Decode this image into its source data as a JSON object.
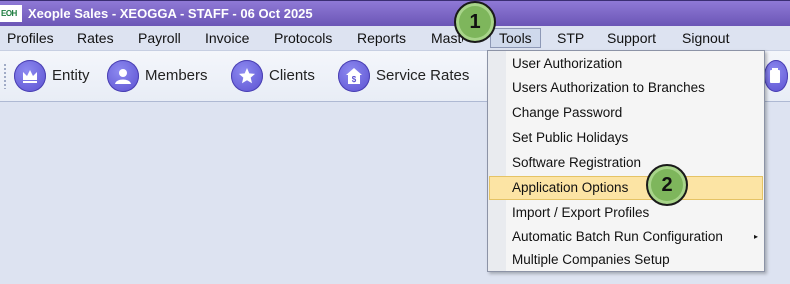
{
  "window": {
    "logo_text": "EOH",
    "title": "Xeople Sales - XEOGGA - STAFF - 06 Oct 2025"
  },
  "menu": [
    {
      "label": "Profiles"
    },
    {
      "label": "Rates"
    },
    {
      "label": "Payroll"
    },
    {
      "label": "Invoice"
    },
    {
      "label": "Protocols"
    },
    {
      "label": "Reports"
    },
    {
      "label": "Masters"
    },
    {
      "label": "Tools",
      "active": true
    },
    {
      "label": "STP"
    },
    {
      "label": "Support"
    },
    {
      "label": "Signout"
    }
  ],
  "toolbar": [
    {
      "label": "Entity",
      "icon": "crown-icon"
    },
    {
      "label": "Members",
      "icon": "user-icon"
    },
    {
      "label": "Clients",
      "icon": "star-icon"
    },
    {
      "label": "Service Rates",
      "icon": "dollar-house-icon"
    }
  ],
  "toolbar_overflow_icon": "clipboard-icon",
  "tools_menu": [
    {
      "label": "User Authorization"
    },
    {
      "label": "Users Authorization to Branches"
    },
    {
      "label": "Change Password"
    },
    {
      "label": "Set Public Holidays"
    },
    {
      "label": "Software Registration"
    },
    {
      "label": "Application Options",
      "highlighted": true
    },
    {
      "label": "Import / Export Profiles"
    },
    {
      "label": "Automatic Batch Run Configuration",
      "submenu": true
    },
    {
      "label": "Multiple Companies Setup"
    }
  ],
  "submenu_arrow": "▸",
  "step_badges": [
    {
      "number": "1"
    },
    {
      "number": "2"
    }
  ],
  "colors": {
    "titlebar": "#7a64c8",
    "menu_highlight": "#fce4a4",
    "badge": "#7eb65c",
    "background": "#dde3f1"
  }
}
